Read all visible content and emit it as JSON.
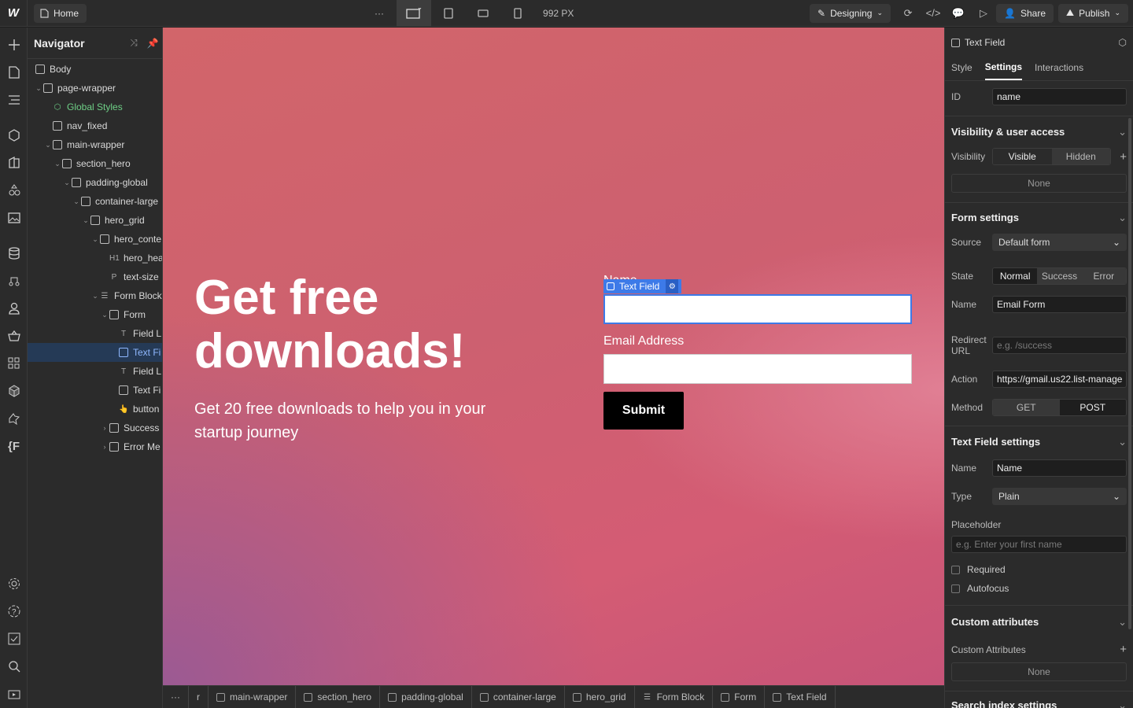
{
  "topbar": {
    "home_label": "Home",
    "width_label": "992 PX",
    "mode_label": "Designing",
    "share_label": "Share",
    "publish_label": "Publish"
  },
  "navigator": {
    "title": "Navigator",
    "items": [
      {
        "label": "Body"
      },
      {
        "label": "page-wrapper"
      },
      {
        "label": "Global Styles"
      },
      {
        "label": "nav_fixed"
      },
      {
        "label": "main-wrapper"
      },
      {
        "label": "section_hero"
      },
      {
        "label": "padding-global"
      },
      {
        "label": "container-large"
      },
      {
        "label": "hero_grid"
      },
      {
        "label": "hero_conte"
      },
      {
        "label": "hero_hea"
      },
      {
        "label": "text-size"
      },
      {
        "label": "Form Block"
      },
      {
        "label": "Form"
      },
      {
        "label": "Field L"
      },
      {
        "label": "Text Fi"
      },
      {
        "label": "Field L"
      },
      {
        "label": "Text Fi"
      },
      {
        "label": "button"
      },
      {
        "label": "Success"
      },
      {
        "label": "Error Me"
      }
    ],
    "glyphs": {
      "h1": "H1",
      "p": "P",
      "t": "T"
    }
  },
  "canvas": {
    "hero_title": "Get free downloads!",
    "hero_subtitle": "Get 20 free downloads to help you in your startup journey",
    "name_label": "Name",
    "selection_tag": "Text Field",
    "email_label": "Email Address",
    "submit_label": "Submit"
  },
  "breadcrumb": {
    "items": [
      "r",
      "main-wrapper",
      "section_hero",
      "padding-global",
      "container-large",
      "hero_grid",
      "Form Block",
      "Form",
      "Text Field"
    ]
  },
  "panel": {
    "element_title": "Text Field",
    "tabs": [
      "Style",
      "Settings",
      "Interactions"
    ],
    "id_label": "ID",
    "id_value": "name",
    "visibility_section": "Visibility & user access",
    "visibility_label": "Visibility",
    "visible_option": "Visible",
    "hidden_option": "Hidden",
    "none_label": "None",
    "form_section": "Form settings",
    "source_label": "Source",
    "source_value": "Default form",
    "state_label": "State",
    "state_options": [
      "Normal",
      "Success",
      "Error"
    ],
    "form_name_label": "Name",
    "form_name_value": "Email Form",
    "redirect_label": "Redirect URL",
    "redirect_placeholder": "e.g. /success",
    "action_label": "Action",
    "action_value": "https://gmail.us22.list-manage",
    "method_label": "Method",
    "method_options": [
      "GET",
      "POST"
    ],
    "textfield_section": "Text Field settings",
    "tf_name_label": "Name",
    "tf_name_value": "Name",
    "type_label": "Type",
    "type_value": "Plain",
    "placeholder_label": "Placeholder",
    "placeholder_hint": "e.g. Enter your first name",
    "required_label": "Required",
    "autofocus_label": "Autofocus",
    "custom_section": "Custom attributes",
    "custom_attr_label": "Custom Attributes",
    "custom_none": "None",
    "search_section": "Search index settings"
  }
}
